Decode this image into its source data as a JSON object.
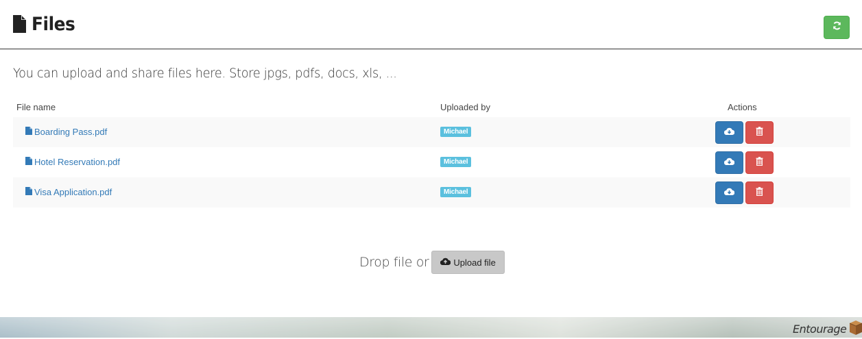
{
  "header": {
    "title": "Files",
    "title_icon": "file-icon",
    "refresh_icon": "refresh-icon"
  },
  "intro": "You can upload and share files here. Store jpgs, pdfs, docs, xls, ...",
  "table": {
    "columns": [
      "File name",
      "Uploaded by",
      "Actions"
    ],
    "rows": [
      {
        "file": "Boarding Pass.pdf",
        "uploaded_by": "Michael"
      },
      {
        "file": "Hotel Reservation.pdf",
        "uploaded_by": "Michael"
      },
      {
        "file": "Visa Application.pdf",
        "uploaded_by": "Michael"
      }
    ],
    "row_actions": {
      "download_icon": "cloud-download-icon",
      "delete_icon": "trash-icon"
    }
  },
  "upload": {
    "drop_text": "Drop file or",
    "button_label": "Upload file",
    "button_icon": "cloud-upload-icon"
  },
  "footer": {
    "brand": "Entourage",
    "brand_icon": "box-icon"
  },
  "colors": {
    "success": "#5cb85c",
    "primary": "#337ab7",
    "danger": "#d9534f",
    "info": "#5bc0de",
    "link": "#337ab7"
  }
}
